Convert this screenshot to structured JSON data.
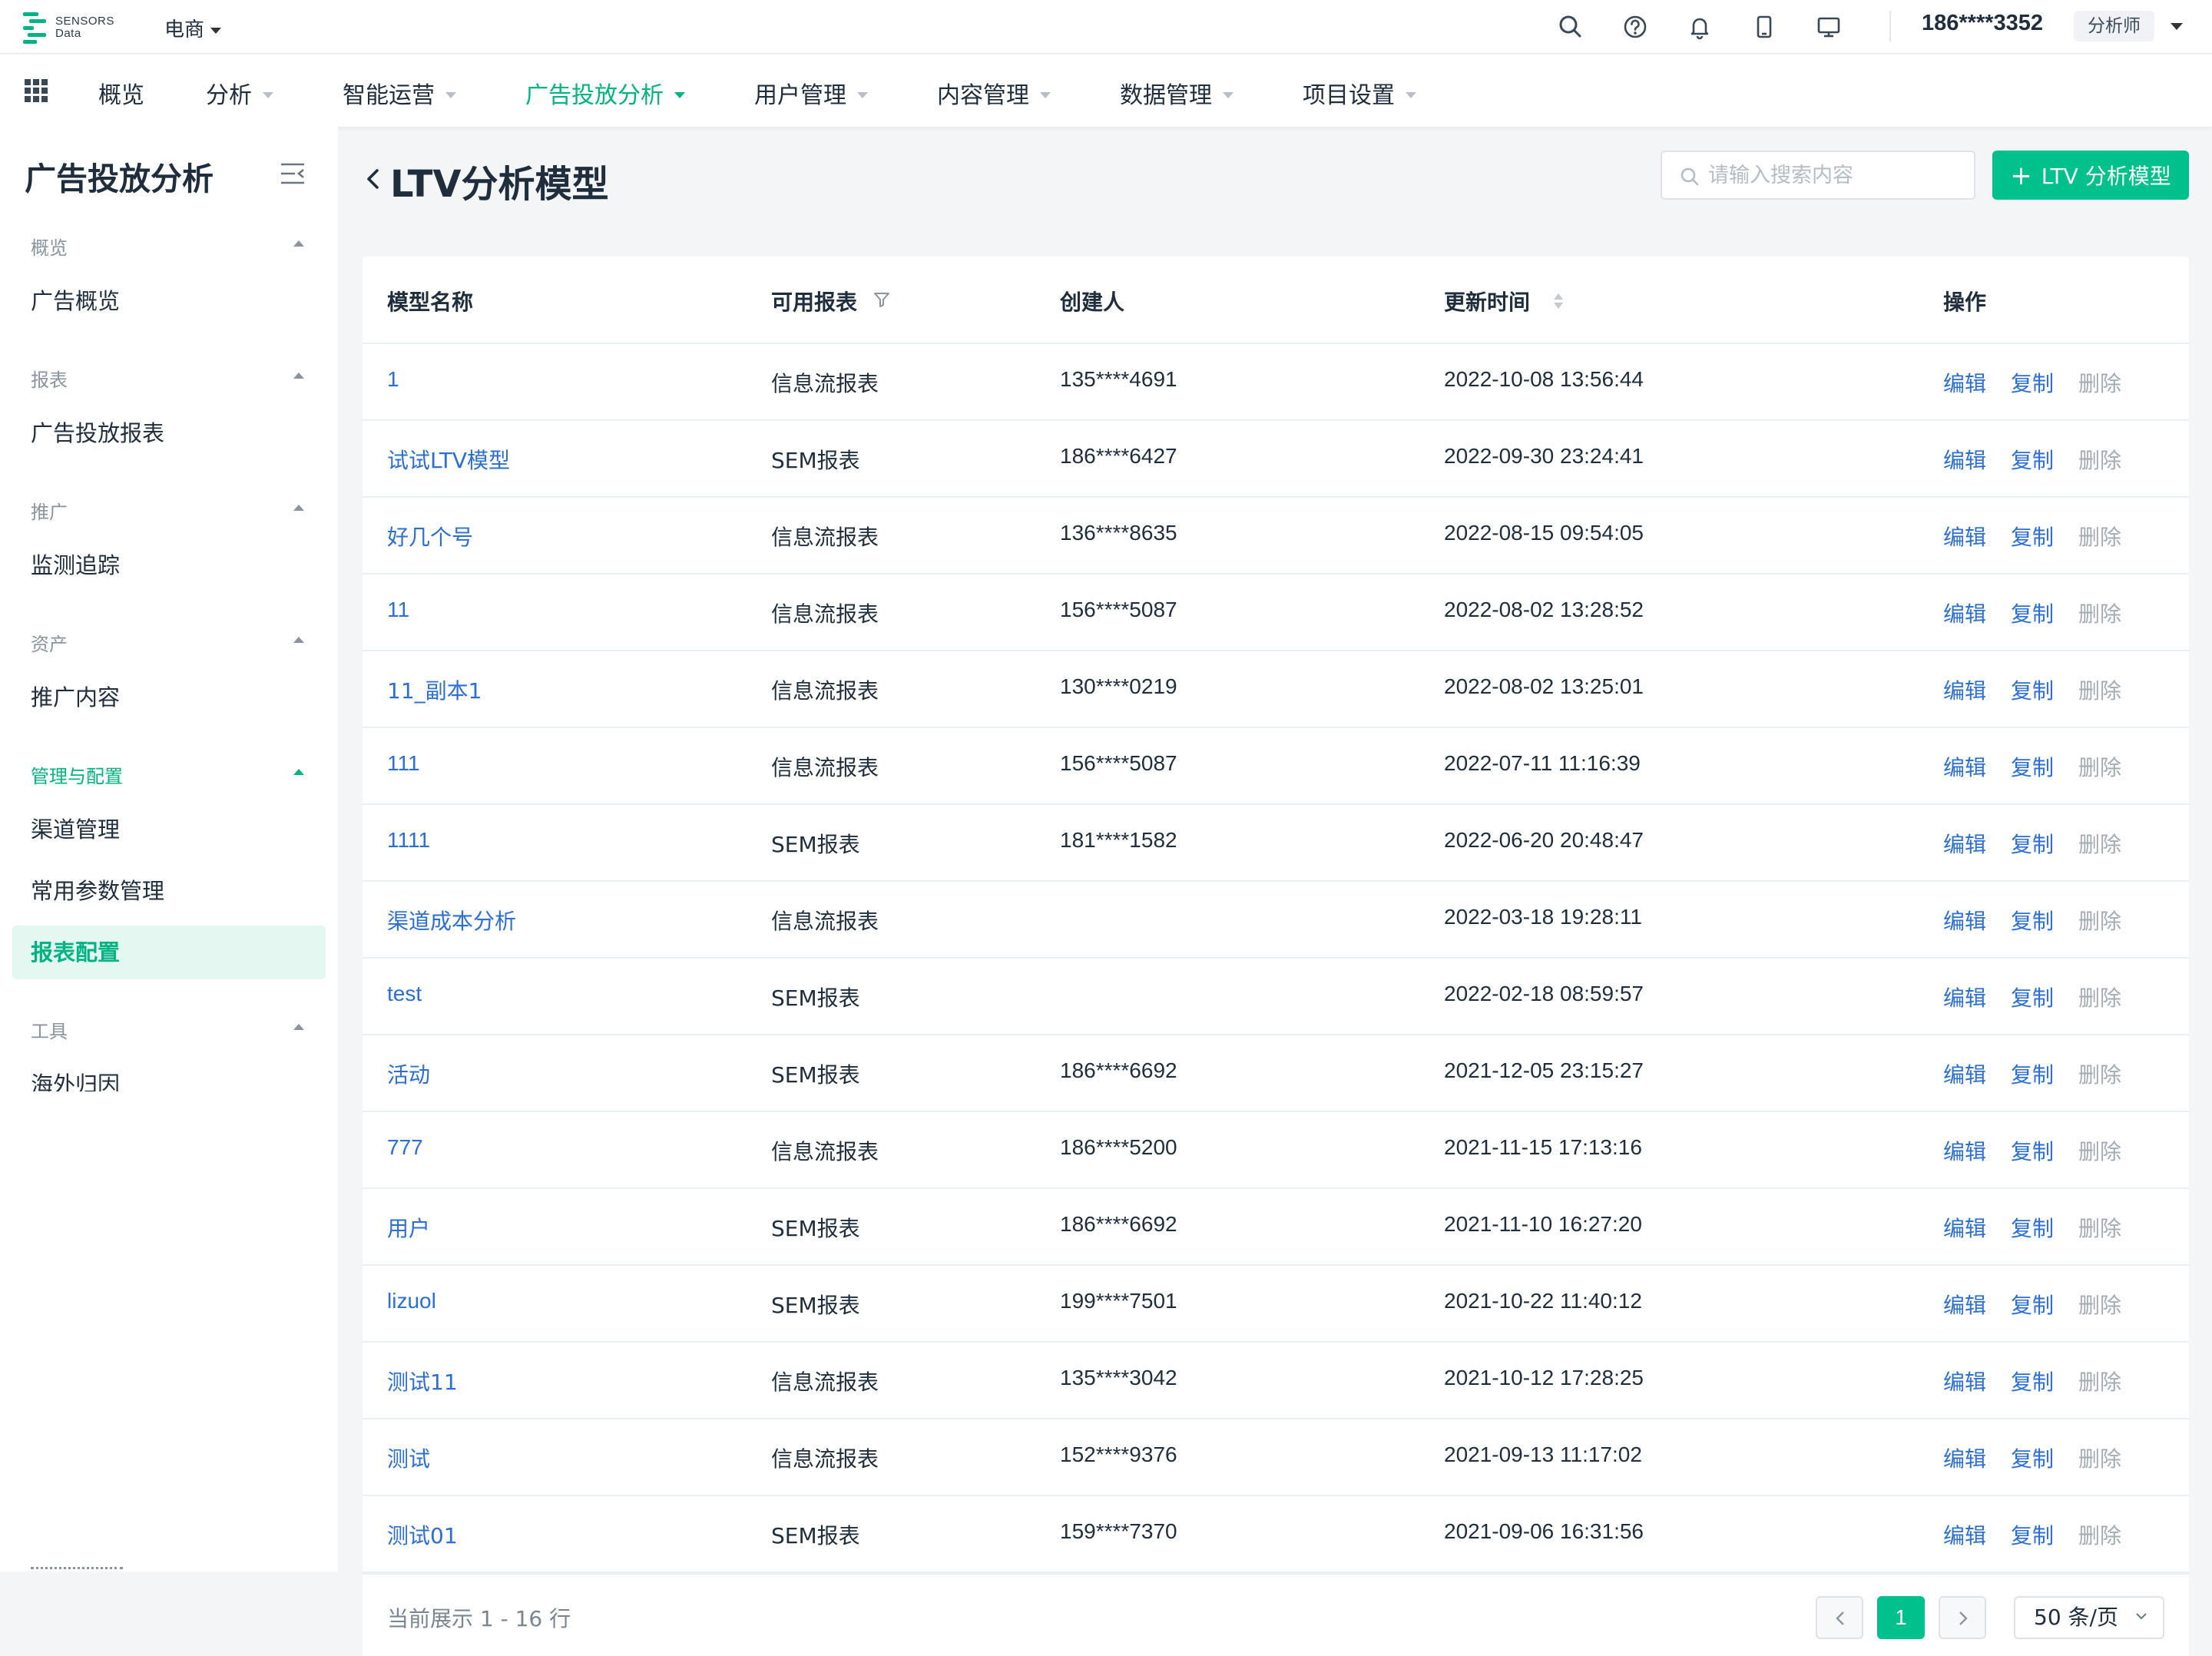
{
  "header": {
    "logo_text_1": "SENSORS",
    "logo_text_2": "Data",
    "project": "电商",
    "icons": [
      "search-icon",
      "help-icon",
      "bell-icon",
      "mobile-icon",
      "monitor-icon"
    ],
    "user_phone": "186****3352",
    "role": "分析师"
  },
  "nav": {
    "items": [
      {
        "label": "概览",
        "has_caret": false
      },
      {
        "label": "分析",
        "has_caret": true
      },
      {
        "label": "智能运营",
        "has_caret": true
      },
      {
        "label": "广告投放分析",
        "has_caret": true,
        "active": true
      },
      {
        "label": "用户管理",
        "has_caret": true
      },
      {
        "label": "内容管理",
        "has_caret": true
      },
      {
        "label": "数据管理",
        "has_caret": true
      },
      {
        "label": "项目设置",
        "has_caret": true
      }
    ]
  },
  "sidebar": {
    "title": "广告投放分析",
    "groups": [
      {
        "label": "概览",
        "items": [
          "广告概览"
        ]
      },
      {
        "label": "报表",
        "items": [
          "广告投放报表"
        ]
      },
      {
        "label": "推广",
        "items": [
          "监测追踪"
        ]
      },
      {
        "label": "资产",
        "items": [
          "推广内容"
        ]
      },
      {
        "label": "管理与配置",
        "active": true,
        "items": [
          "渠道管理",
          "常用参数管理",
          "报表配置"
        ]
      },
      {
        "label": "工具",
        "items": [
          "海外归因"
        ]
      }
    ],
    "active_item": "报表配置"
  },
  "page": {
    "title": "LTV分析模型",
    "search_placeholder": "请输入搜索内容",
    "add_button": "LTV 分析模型"
  },
  "table": {
    "columns": [
      "模型名称",
      "可用报表",
      "创建人",
      "更新时间",
      "操作"
    ],
    "ops": {
      "edit": "编辑",
      "copy": "复制",
      "delete": "删除"
    },
    "rows": [
      {
        "name": "1",
        "report": "信息流报表",
        "creator": "135****4691",
        "updated": "2022-10-08 13:56:44"
      },
      {
        "name": "试试LTV模型",
        "report": "SEM报表",
        "creator": "186****6427",
        "updated": "2022-09-30 23:24:41"
      },
      {
        "name": "好几个号",
        "report": "信息流报表",
        "creator": "136****8635",
        "updated": "2022-08-15 09:54:05"
      },
      {
        "name": "11",
        "report": "信息流报表",
        "creator": "156****5087",
        "updated": "2022-08-02 13:28:52"
      },
      {
        "name": "11_副本1",
        "report": "信息流报表",
        "creator": "130****0219",
        "updated": "2022-08-02 13:25:01"
      },
      {
        "name": "111",
        "report": "信息流报表",
        "creator": "156****5087",
        "updated": "2022-07-11 11:16:39"
      },
      {
        "name": "1111",
        "report": "SEM报表",
        "creator": "181****1582",
        "updated": "2022-06-20 20:48:47"
      },
      {
        "name": "渠道成本分析",
        "report": "信息流报表",
        "creator": "",
        "updated": "2022-03-18 19:28:11"
      },
      {
        "name": "test",
        "report": "SEM报表",
        "creator": "",
        "updated": "2022-02-18 08:59:57"
      },
      {
        "name": "活动",
        "report": "SEM报表",
        "creator": "186****6692",
        "updated": "2021-12-05 23:15:27"
      },
      {
        "name": "777",
        "report": "信息流报表",
        "creator": "186****5200",
        "updated": "2021-11-15 17:13:16"
      },
      {
        "name": "用户",
        "report": "SEM报表",
        "creator": "186****6692",
        "updated": "2021-11-10 16:27:20"
      },
      {
        "name": "lizuol",
        "report": "SEM报表",
        "creator": "199****7501",
        "updated": "2021-10-22 11:40:12"
      },
      {
        "name": "测试11",
        "report": "信息流报表",
        "creator": "135****3042",
        "updated": "2021-10-12 17:28:25"
      },
      {
        "name": "测试",
        "report": "信息流报表",
        "creator": "152****9376",
        "updated": "2021-09-13 11:17:02"
      },
      {
        "name": "测试01",
        "report": "SEM报表",
        "creator": "159****7370",
        "updated": "2021-09-06 16:31:56"
      }
    ]
  },
  "pagination": {
    "summary": "当前展示 1 - 16 行",
    "current_page": "1",
    "page_size": "50 条/页"
  },
  "colors": {
    "accent": "#00c08b",
    "link": "#2b6fd6",
    "muted": "#a4abb3"
  }
}
